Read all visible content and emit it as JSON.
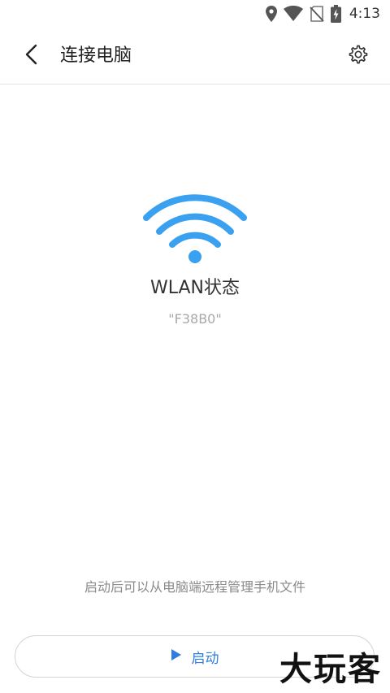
{
  "status_bar": {
    "time": "4:13",
    "icons": [
      "location-icon",
      "wifi-signal-icon",
      "no-sim-icon",
      "battery-charging-icon"
    ]
  },
  "header": {
    "back_icon": "chevron-left-icon",
    "title": "连接电脑",
    "settings_icon": "gear-icon"
  },
  "main": {
    "wifi_icon": "wifi-icon",
    "wifi_color": "#3aa0f0",
    "status_title": "WLAN状态",
    "network_name": "\"F38B0\""
  },
  "footer": {
    "hint": "启动后可以从电脑端远程管理手机文件",
    "start_button": {
      "icon": "play-icon",
      "label": "启动",
      "accent_color": "#2f7dde"
    }
  },
  "watermark": {
    "text": "大玩客"
  }
}
